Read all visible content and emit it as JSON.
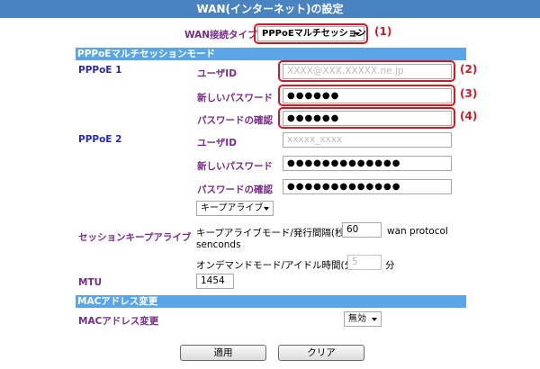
{
  "page": {
    "title": "WAN(インターネット)の設定"
  },
  "wan_type": {
    "label": "WAN接続タイプ",
    "selected": "PPPoEマルチセッション",
    "marker": "(1)"
  },
  "pppoe_section": {
    "heading": "PPPoEマルチセッションモード"
  },
  "pppoe1": {
    "label": "PPPoE 1",
    "user_id_label": "ユーザID",
    "user_id_value": "XXXX@XXX.XXXXX.ne.jp",
    "user_id_marker": "(2)",
    "new_password_label": "新しいパスワード",
    "new_password_value": "●●●●●●",
    "new_password_marker": "(3)",
    "confirm_password_label": "パスワードの確認",
    "confirm_password_value": "●●●●●●",
    "confirm_password_marker": "(4)"
  },
  "pppoe2": {
    "label": "PPPoE 2",
    "user_id_label": "ユーザID",
    "user_id_value": "xxxxx_xxxx",
    "new_password_label": "新しいパスワード",
    "new_password_value": "●●●●●●●●●●●●●",
    "confirm_password_label": "パスワードの確認",
    "confirm_password_value": "●●●●●●●●●●●●●"
  },
  "keepalive": {
    "select_value": "キープアライブ",
    "label": "セッションキープアライブ",
    "mode_label": "キープアライブモード/発行間隔(秒):",
    "interval_value": "60",
    "protocol_text": "wan protocol",
    "seconds_text": "senconds",
    "ondemand_label": "オンデマンドモード/アイドル時間(分):",
    "idle_value": "5",
    "idle_unit": "分"
  },
  "mtu": {
    "label": "MTU",
    "value": "1454"
  },
  "mac_section": {
    "heading": "MACアドレス変更"
  },
  "mac": {
    "label": "MACアドレス変更",
    "selected": "無効"
  },
  "buttons": {
    "apply": "適用",
    "clear": "クリア"
  },
  "colors": {
    "title_bar": "#4a84c0",
    "section_bar": "#5aa5e6",
    "highlight": "#e0141e",
    "label_blue": "#2828b8",
    "label_purple": "#7a2a8a"
  }
}
